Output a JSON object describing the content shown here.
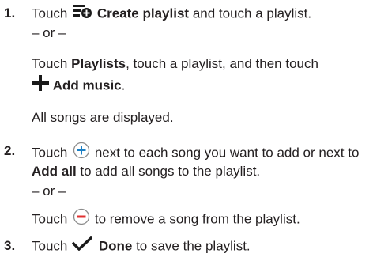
{
  "steps": [
    {
      "number": "1.",
      "line1_prefix": "Touch",
      "create_playlist_icon": "create-playlist-icon",
      "create_playlist_label": "Create playlist",
      "line1_suffix": "and touch a playlist.",
      "or_text": "– or –",
      "alt_prefix": "Touch",
      "playlists_label": "Playlists",
      "alt_suffix": ", touch a playlist, and then touch",
      "add_music_icon": "plus-icon",
      "add_music_label": "Add music",
      "add_music_period": ".",
      "result_text": "All songs are displayed."
    },
    {
      "number": "2.",
      "line1_prefix": "Touch",
      "add_icon": "circle-plus-icon",
      "line1_suffix": "next to each song you want to add or next to",
      "add_all_label": "Add all",
      "line2_suffix": "to add all songs to the playlist.",
      "or_text": "– or –",
      "remove_prefix": "Touch",
      "remove_icon": "circle-minus-icon",
      "remove_suffix": "to remove a song from the playlist."
    },
    {
      "number": "3.",
      "line1_prefix": "Touch",
      "done_icon": "checkmark-icon",
      "done_label": "Done",
      "line1_suffix": "to save the playlist."
    }
  ],
  "colors": {
    "text": "#231f20",
    "icon_blue": "#1b7fc4",
    "icon_red": "#e03131",
    "icon_dark": "#1a1a1a"
  }
}
